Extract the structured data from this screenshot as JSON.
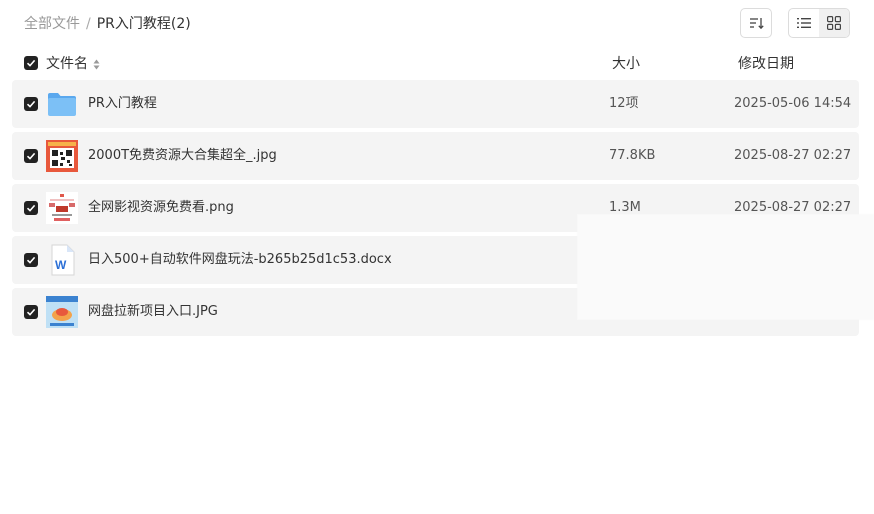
{
  "breadcrumb": {
    "root": "全部文件",
    "separator": "/",
    "current": "PR入门教程(2)"
  },
  "toolbar": {
    "sort_icon": "sort-icon",
    "list_view_icon": "list-view-icon",
    "grid_view_icon": "grid-view-icon",
    "active_view": "list"
  },
  "columns": {
    "name": "文件名",
    "size": "大小",
    "date": "修改日期"
  },
  "files": [
    {
      "name": "PR入门教程",
      "size": "12项",
      "date": "2025-05-06 14:54",
      "type": "folder",
      "checked": true
    },
    {
      "name": "2000T免费资源大合集超全_.jpg",
      "size": "77.8KB",
      "date": "2025-08-27 02:27",
      "type": "image-qr",
      "checked": true
    },
    {
      "name": "全网影视资源免费看.png",
      "size": "1.3M",
      "date": "2025-08-27 02:27",
      "type": "image-doc",
      "checked": true
    },
    {
      "name": "日入500+自动软件网盘玩法-b265b25d1c53.docx",
      "size": "",
      "date": "",
      "type": "word",
      "checked": true
    },
    {
      "name": "网盘拉新项目入口.JPG",
      "size": "",
      "date": "",
      "type": "image-photo",
      "checked": true
    }
  ],
  "colors": {
    "row_bg": "#f4f4f4",
    "checkbox": "#222222",
    "folder": "#6fb4f2",
    "word_blue": "#2b6fd6"
  }
}
